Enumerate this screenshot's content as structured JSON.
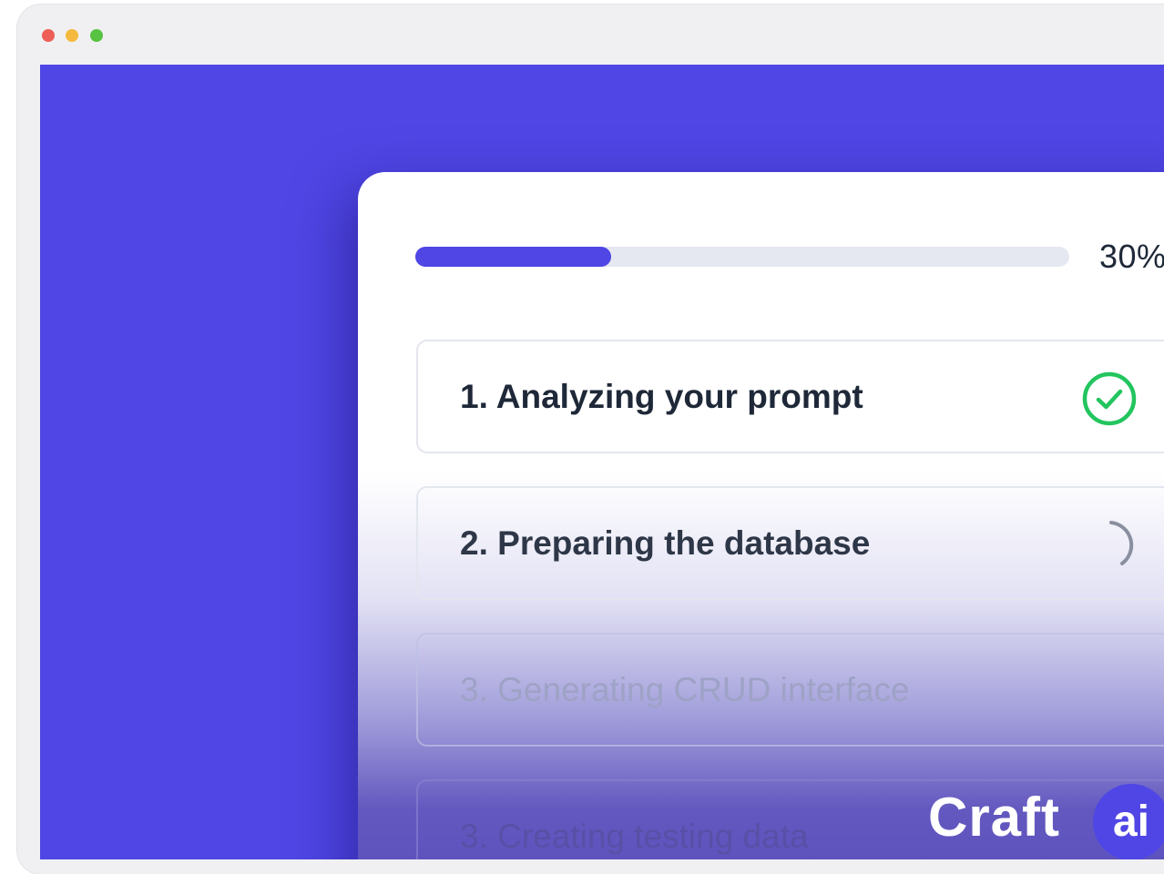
{
  "window": {
    "controls": {
      "close_color": "#ed5f57",
      "minimize_color": "#f4b93e",
      "maximize_color": "#58c343"
    }
  },
  "theme": {
    "background_color": "#4f46e5",
    "accent_color": "#4f46e5",
    "success_color": "#22c55e"
  },
  "progress": {
    "value": 0.3,
    "label": "30%"
  },
  "steps": [
    {
      "label": "1. Analyzing your prompt",
      "status": "complete",
      "icon": "check-circle-icon"
    },
    {
      "label": "2. Preparing the database",
      "status": "in-progress",
      "icon": "spinner-icon"
    },
    {
      "label": "3. Generating CRUD interface",
      "status": "pending"
    },
    {
      "label": "3. Creating testing data",
      "status": "pending"
    }
  ],
  "logo": {
    "text": "Craft",
    "badge": "ai"
  }
}
